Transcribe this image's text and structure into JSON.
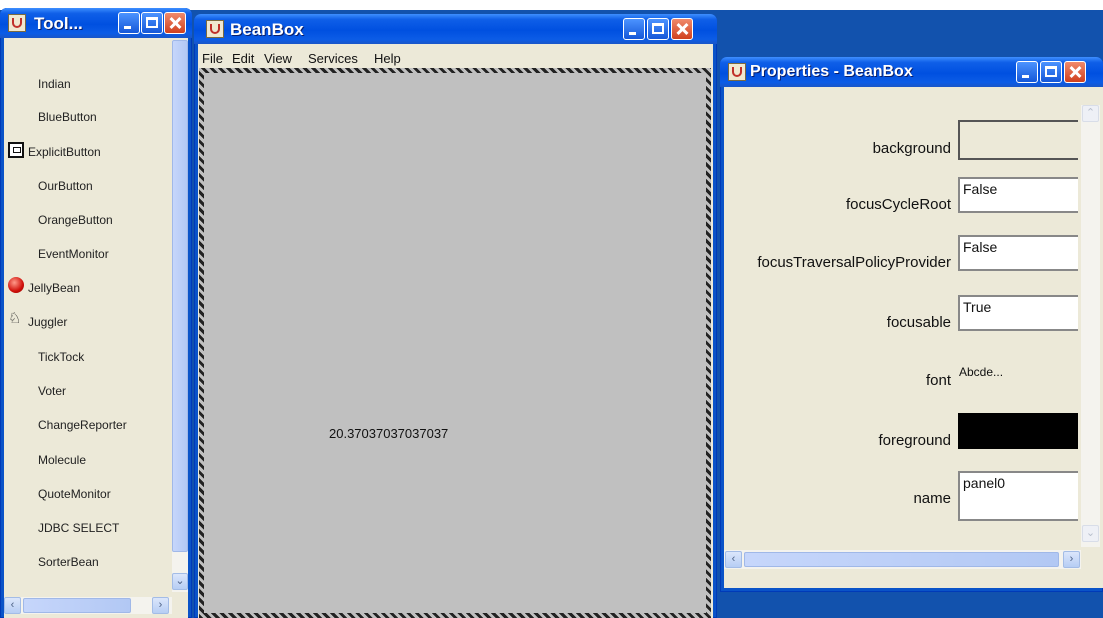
{
  "toolbox": {
    "title": "Tool...",
    "items": [
      {
        "label": "Indian"
      },
      {
        "label": "BlueButton"
      },
      {
        "label": "ExplicitButton",
        "icon": "explicit-button-icon"
      },
      {
        "label": "OurButton"
      },
      {
        "label": "OrangeButton"
      },
      {
        "label": "EventMonitor"
      },
      {
        "label": "JellyBean",
        "icon": "jellybean-icon"
      },
      {
        "label": "Juggler",
        "icon": "juggler-icon"
      },
      {
        "label": "TickTock"
      },
      {
        "label": "Voter"
      },
      {
        "label": "ChangeReporter"
      },
      {
        "label": "Molecule"
      },
      {
        "label": "QuoteMonitor"
      },
      {
        "label": "JDBC SELECT"
      },
      {
        "label": "SorterBean"
      }
    ]
  },
  "beanbox": {
    "title": "BeanBox",
    "menu": [
      "File",
      "Edit",
      "View",
      "Services",
      "Help"
    ],
    "canvas_value": "20.37037037037037"
  },
  "properties": {
    "title": "Properties - BeanBox",
    "rows": [
      {
        "label": "background",
        "value": "",
        "kind": "color",
        "color": "#ece9d8"
      },
      {
        "label": "focusCycleRoot",
        "value": "False",
        "kind": "text"
      },
      {
        "label": "focusTraversalPolicyProvider",
        "value": "False",
        "kind": "text"
      },
      {
        "label": "focusable",
        "value": "True",
        "kind": "text"
      },
      {
        "label": "font",
        "value": "Abcde...",
        "kind": "font"
      },
      {
        "label": "foreground",
        "value": "",
        "kind": "color",
        "color": "#000000"
      },
      {
        "label": "name",
        "value": "panel0",
        "kind": "text"
      }
    ]
  },
  "colors": {
    "desktop": "#1252ad",
    "titlebar": "#0050e0",
    "window_bg": "#ece9d8",
    "canvas": "#c0c0c0"
  }
}
